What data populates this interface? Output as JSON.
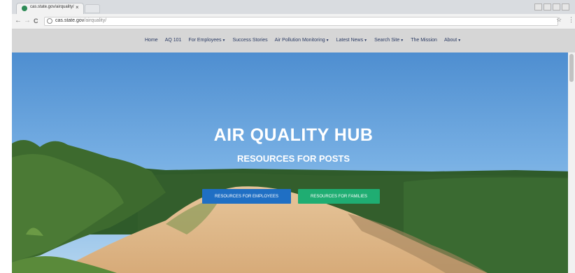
{
  "browser": {
    "tab_title": "cas.state.gov/airquality/",
    "tab_close": "×",
    "url_host": "cas.state.gov",
    "url_path": "/airquality/",
    "star_glyph": "☆",
    "menu_glyph": "⋮",
    "back_glyph": "←",
    "forward_glyph": "→",
    "reload_glyph": "C"
  },
  "nav": {
    "items": [
      {
        "label": "Home",
        "dropdown": false
      },
      {
        "label": "AQ 101",
        "dropdown": false
      },
      {
        "label": "For Employees",
        "dropdown": true
      },
      {
        "label": "Success Stories",
        "dropdown": false
      },
      {
        "label": "Air Pollution Monitoring",
        "dropdown": true
      },
      {
        "label": "Latest News",
        "dropdown": true
      },
      {
        "label": "Search Site",
        "dropdown": true
      },
      {
        "label": "The Mission",
        "dropdown": false
      },
      {
        "label": "About",
        "dropdown": true
      }
    ],
    "caret_glyph": "▼"
  },
  "hero": {
    "title": "AIR QUALITY HUB",
    "subtitle": "RESOURCES FOR POSTS",
    "btn_employees": "RESOURCES FOR EMPLOYEES",
    "btn_families": "RESOURCES FOR FAMILIES"
  },
  "colors": {
    "nav_bg": "#d6d6d6",
    "nav_text": "#2a3a63",
    "btn_employees": "#1f6fc4",
    "btn_families": "#1fad72"
  }
}
